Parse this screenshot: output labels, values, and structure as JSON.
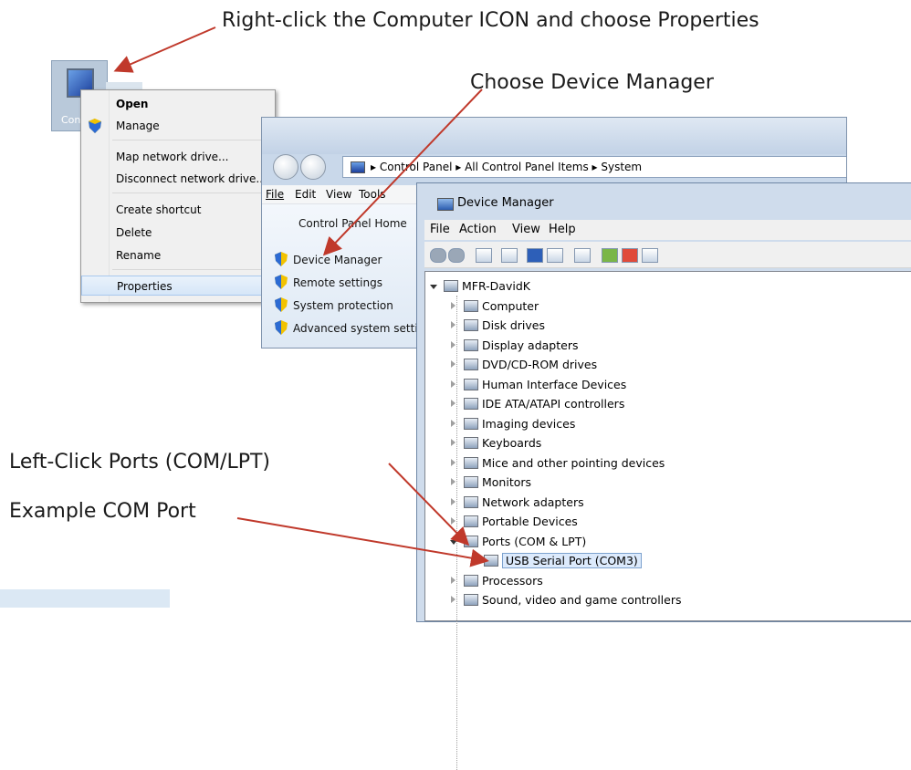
{
  "annotations": {
    "right_click": "Right-click the Computer ICON and choose Properties",
    "device_manager": "Choose Device Manager",
    "left_click_ports": "Left-Click Ports (COM/LPT)",
    "example_port": "Example COM Port"
  },
  "desktop_icon": {
    "label": "Con"
  },
  "context_menu": {
    "items": [
      "Open",
      "Manage",
      "Map network drive...",
      "Disconnect network drive...",
      "Create shortcut",
      "Delete",
      "Rename",
      "Properties"
    ]
  },
  "system_window": {
    "breadcrumb": [
      "Control Panel",
      "All Control Panel Items",
      "System"
    ],
    "menu": [
      "File",
      "Edit",
      "View",
      "Tools"
    ],
    "left_pane": {
      "home": "Control Panel Home",
      "links": [
        "Device Manager",
        "Remote settings",
        "System protection",
        "Advanced system settings"
      ]
    }
  },
  "device_manager": {
    "title": "Device Manager",
    "menu": [
      "File",
      "Action",
      "View",
      "Help"
    ],
    "root": "MFR-DavidK",
    "nodes": [
      "Computer",
      "Disk drives",
      "Display adapters",
      "DVD/CD-ROM drives",
      "Human Interface Devices",
      "IDE ATA/ATAPI controllers",
      "Imaging devices",
      "Keyboards",
      "Mice and other pointing devices",
      "Monitors",
      "Network adapters",
      "Portable Devices",
      "Ports (COM & LPT)",
      "Processors",
      "Sound, video and game controllers"
    ],
    "ports_child": "USB Serial Port (COM3)"
  },
  "colors": {
    "arrow": "#c0392b",
    "window_frame": "#cfdcec",
    "selection": "#dceafc"
  }
}
